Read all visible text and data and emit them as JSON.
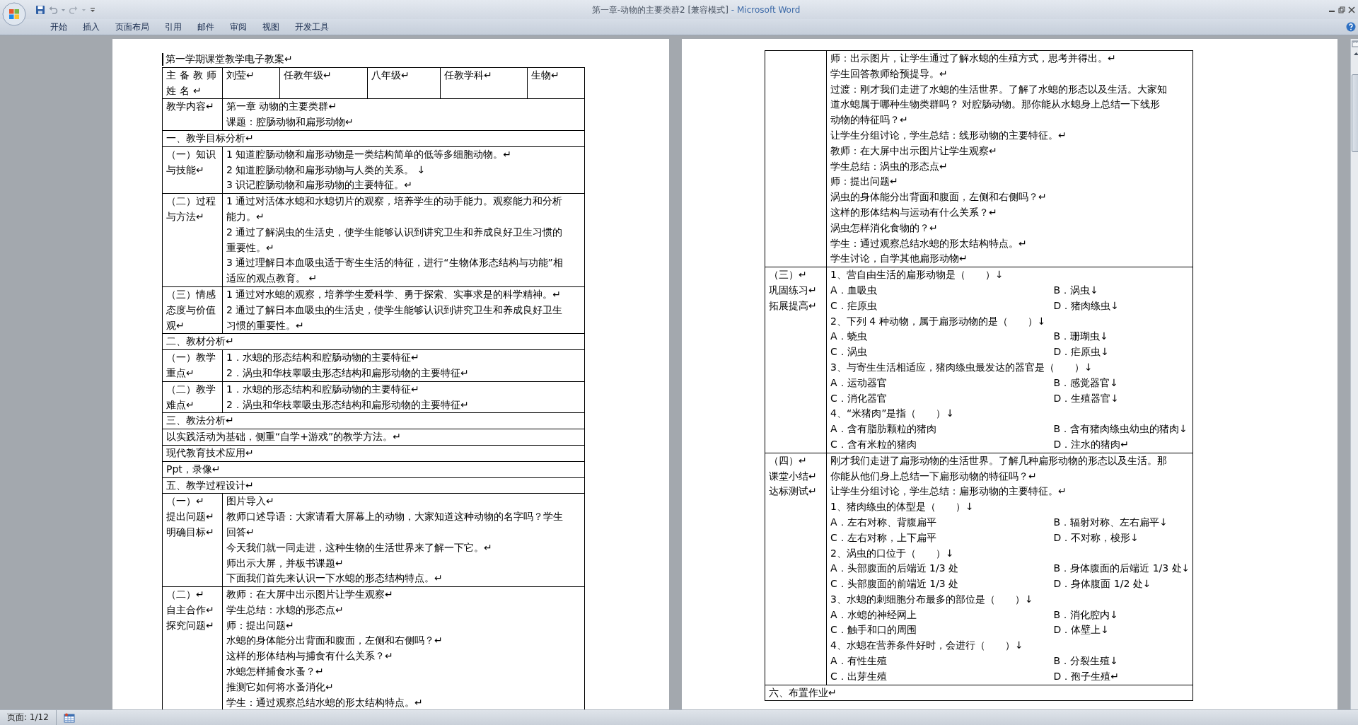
{
  "window": {
    "document_title": "第一章-动物的主要类群2 [兼容模式]",
    "app_name": "- Microsoft Word"
  },
  "ribbon_tabs": [
    "开始",
    "插入",
    "页面布局",
    "引用",
    "邮件",
    "审阅",
    "视图",
    "开发工具"
  ],
  "pages": [
    {
      "header": "第一学期课堂教学电子教案↵",
      "rows": [
        {
          "kind": "cells",
          "cells": [
            "主备教师姓名↵",
            "刘莹↵",
            "任教年级↵",
            "八年级↵",
            "任教学科↵",
            "生物↵"
          ]
        },
        {
          "kind": "labeled",
          "label": [
            "教学内容↵"
          ],
          "lines": [
            {
              "kind": "text",
              "text": "第一章 动物的主要类群↵"
            },
            {
              "kind": "text",
              "text": "课题：腔肠动物和扁形动物↵"
            }
          ]
        },
        {
          "kind": "section",
          "text": "一、教学目标分析↵"
        },
        {
          "kind": "labeled",
          "label": [
            "（一）知识与技能↵"
          ],
          "lines": [
            {
              "kind": "text",
              "text": "1 知道腔肠动物和扁形动物是一类结构简单的低等多细胞动物。↵"
            },
            {
              "kind": "text",
              "text": "2 知道腔肠动物和扁形动物与人类的关系。 ↓"
            },
            {
              "kind": "text",
              "text": "3 识记腔肠动物和扁形动物的主要特征。↵"
            }
          ]
        },
        {
          "kind": "labeled",
          "label": [
            "（二）过程与方法↵"
          ],
          "lines": [
            {
              "kind": "text",
              "text": "1 通过对活体水螅和水螅切片的观察，培养学生的动手能力。观察能力和分析能力。↵"
            },
            {
              "kind": "text",
              "text": "2 通过了解涡虫的生活史，使学生能够认识到讲究卫生和养成良好卫生习惯的重要性。↵"
            },
            {
              "kind": "text",
              "text": "3 通过理解日本血吸虫适于寄生生活的特征，进行“生物体形态结构与功能”相适应的观点教育。 ↵"
            }
          ]
        },
        {
          "kind": "labeled",
          "label": [
            "（三）情感态度与价值观↵"
          ],
          "lines": [
            {
              "kind": "text",
              "text": "1 通过对水螅的观察，培养学生爱科学、勇于探索、实事求是的科学精神。↵"
            },
            {
              "kind": "text",
              "text": "2 通过了解日本血吸虫的生活史，使学生能够认识到讲究卫生和养成良好卫生习惯的重要性。↵"
            }
          ]
        },
        {
          "kind": "section",
          "text": "二、教材分析↵"
        },
        {
          "kind": "labeled",
          "label": [
            "（一）教学重点↵"
          ],
          "lines": [
            {
              "kind": "text",
              "text": "1．水螅的形态结构和腔肠动物的主要特征↵"
            },
            {
              "kind": "text",
              "text": "2．涡虫和华枝睾吸虫形态结构和扁形动物的主要特征↵"
            }
          ]
        },
        {
          "kind": "labeled",
          "label": [
            "（二）教学难点↵"
          ],
          "lines": [
            {
              "kind": "text",
              "text": "1．水螅的形态结构和腔肠动物的主要特征↵"
            },
            {
              "kind": "text",
              "text": "2．涡虫和华枝睾吸虫形态结构和扁形动物的主要特征↵"
            }
          ]
        },
        {
          "kind": "section",
          "text": "三、教法分析↵"
        },
        {
          "kind": "section",
          "text": "以实践活动为基础，侧重“自学+游戏”的教学方法。↵"
        },
        {
          "kind": "section",
          "text": "现代教育技术应用↵"
        },
        {
          "kind": "section",
          "text": "Ppt，录像↵"
        },
        {
          "kind": "section",
          "text": "五、教学过程设计↵"
        },
        {
          "kind": "labeled",
          "label": [
            "（一）↵",
            "提出问题↵",
            "明确目标↵"
          ],
          "lines": [
            {
              "kind": "text",
              "text": "图片导入↵"
            },
            {
              "kind": "text",
              "text": "教师口述导语：大家请看大屏幕上的动物，大家知道这种动物的名字吗？学生回答↵"
            },
            {
              "kind": "text",
              "text": "今天我们就一同走进，这种生物的生活世界来了解一下它。↵"
            },
            {
              "kind": "text",
              "text": "师出示大屏，并板书课题↵"
            },
            {
              "kind": "text",
              "text": "下面我们首先来认识一下水螅的形态结构特点。↵"
            }
          ]
        },
        {
          "kind": "labeled",
          "label": [
            "（二）↵",
            "自主合作↵",
            "探究问题↵"
          ],
          "lines": [
            {
              "kind": "text",
              "text": "教师：在大屏中出示图片让学生观察↵"
            },
            {
              "kind": "text",
              "text": "学生总结：水螅的形态点↵"
            },
            {
              "kind": "text",
              "text": "师：提出问题↵"
            },
            {
              "kind": "text",
              "text": "水螅的身体能分出背面和腹面，左侧和右侧吗？↵"
            },
            {
              "kind": "text",
              "text": "这样的形体结构与捕食有什么关系？↵"
            },
            {
              "kind": "text",
              "text": "水螅怎样捕食水蚤？↵"
            },
            {
              "kind": "text",
              "text": "推测它如何将水蚤消化↵"
            },
            {
              "kind": "text",
              "text": "学生：通过观察总结水螅的形太结构特点。↵"
            }
          ]
        }
      ]
    },
    {
      "rows": [
        {
          "kind": "labeled",
          "label": [],
          "lines": [
            {
              "kind": "text",
              "text": "师：出示图片，让学生通过了解水螅的生殖方式，思考并得出。↵"
            },
            {
              "kind": "text",
              "text": "学生回答教师给预提导。↵"
            },
            {
              "kind": "text",
              "text": "过渡：刚才我们走进了水螅的生活世界。了解了水螅的形态以及生活。大家知道水螅属于哪种生物类群吗？ 对腔肠动物。那你能从水螅身上总结一下线形动物的特征吗？↵"
            },
            {
              "kind": "text",
              "text": "让学生分组讨论，学生总结：线形动物的主要特征。↵"
            },
            {
              "kind": "text",
              "text": "教师：在大屏中出示图片让学生观察↵"
            },
            {
              "kind": "text",
              "text": "学生总结：涡虫的形态点↵"
            },
            {
              "kind": "text",
              "text": "师：提出问题↵"
            },
            {
              "kind": "text",
              "text": "涡虫的身体能分出背面和腹面，左侧和右侧吗？↵"
            },
            {
              "kind": "text",
              "text": "这样的形体结构与运动有什么关系？↵"
            },
            {
              "kind": "text",
              "text": "涡虫怎样消化食物的？↵"
            },
            {
              "kind": "text",
              "text": "学生：通过观察总结水螅的形太结构特点。↵"
            },
            {
              "kind": "text",
              "text": "学生讨论，自学其他扁形动物↵"
            }
          ]
        },
        {
          "kind": "labeled",
          "label": [
            "（三）↵",
            "巩固练习↵",
            "拓展提高↵"
          ],
          "lines": [
            {
              "kind": "question",
              "text": "1、营自由生活的扁形动物是（　　）↓"
            },
            {
              "kind": "options",
              "left": "A．血吸虫",
              "right": "B．涡虫↓"
            },
            {
              "kind": "options",
              "left": "C．疟原虫",
              "right": "D．猪肉绦虫↓"
            },
            {
              "kind": "question",
              "text": "2、下列 4 种动物，属于扁形动物的是（　　）↓"
            },
            {
              "kind": "options",
              "left": "A．蛲虫",
              "right": "B．珊瑚虫↓"
            },
            {
              "kind": "options",
              "left": "C．涡虫",
              "right": "D．疟原虫↓"
            },
            {
              "kind": "question",
              "text": "3、与寄生生活相适应，猪肉绦虫最发达的器官是（　　）↓"
            },
            {
              "kind": "options",
              "left": "A．运动器官",
              "right": "B．感觉器官↓"
            },
            {
              "kind": "options",
              "left": "C．消化器官",
              "right": "D．生殖器官↓"
            },
            {
              "kind": "question",
              "text": "4、“米猪肉”是指（　　）↓"
            },
            {
              "kind": "options",
              "left": "A．含有脂肪颗粒的猪肉",
              "right": "B．含有猪肉绦虫幼虫的猪肉↓"
            },
            {
              "kind": "options",
              "left": "C．含有米粒的猪肉",
              "right": "D．注水的猪肉↵"
            }
          ]
        },
        {
          "kind": "labeled",
          "label": [
            "（四）↵",
            "课堂小结↵",
            "达标测试↵"
          ],
          "lines": [
            {
              "kind": "text",
              "text": "刚才我们走进了扁形动物的生活世界。了解几种扁形动物的形态以及生活。那你能从他们身上总结一下扁形动物的特征吗？↵"
            },
            {
              "kind": "text",
              "text": "让学生分组讨论，学生总结：扁形动物的主要特征。↵"
            },
            {
              "kind": "question",
              "text": "1、猪肉绦虫的体型是（　　）↓"
            },
            {
              "kind": "options",
              "left": "A．左右对称、背腹扁平",
              "right": "B．辐射对称、左右扁平↓"
            },
            {
              "kind": "options",
              "left": "C．左右对称，上下扁平",
              "right": "D．不对称，梭形↓"
            },
            {
              "kind": "question",
              "text": "2、涡虫的口位于（　　）↓"
            },
            {
              "kind": "options",
              "left": "A．头部腹面的后端近 1/3 处",
              "right": "B．身体腹面的后端近 1/3 处↓"
            },
            {
              "kind": "options",
              "left": "C．头部腹面的前端近 1/3 处",
              "right": "D．身体腹面 1/2 处↓"
            },
            {
              "kind": "question",
              "text": "3、水螅的刺细胞分布最多的部位是（　　）↓"
            },
            {
              "kind": "options",
              "left": "A．水螅的神经网上",
              "right": "B．消化腔内↓"
            },
            {
              "kind": "options",
              "left": "C．触手和口的周围",
              "right": "D．体壁上↓"
            },
            {
              "kind": "question",
              "text": "4、水螅在营养条件好时，会进行（　　）↓"
            },
            {
              "kind": "options",
              "left": "A．有性生殖",
              "right": "B．分裂生殖↓"
            },
            {
              "kind": "options",
              "left": "C．出芽生殖",
              "right": "D．孢子生殖↵"
            }
          ]
        },
        {
          "kind": "section",
          "text": "六、布置作业↵"
        }
      ]
    }
  ],
  "status_bar": {
    "page": "页面: 1/12"
  }
}
